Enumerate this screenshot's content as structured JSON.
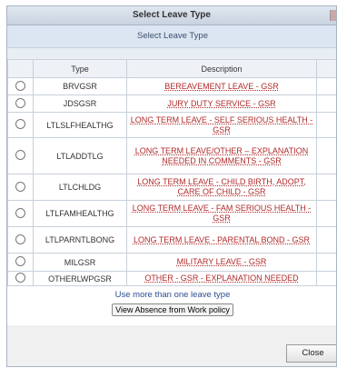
{
  "dialog": {
    "title": "Select Leave Type",
    "subtitle": "Select Leave Type",
    "table": {
      "headers": [
        "Type",
        "Description"
      ],
      "rows": [
        {
          "type": "BRVGSR",
          "description": "BEREAVEMENT LEAVE - GSR"
        },
        {
          "type": "JDSGSR",
          "description": "JURY DUTY SERVICE - GSR"
        },
        {
          "type": "LTLSLFHEALTHG",
          "description": "LONG TERM LEAVE - SELF SERIOUS HEALTH - GSR"
        },
        {
          "type": "LTLADDTLG",
          "description": "LONG TERM LEAVE/OTHER – EXPLANATION NEEDED IN COMMENTS - GSR"
        },
        {
          "type": "LTLCHLDG",
          "description": "LONG TERM LEAVE - CHILD BIRTH, ADOPT, CARE OF CHILD - GSR"
        },
        {
          "type": "LTLFAMHEALTHG",
          "description": "LONG TERM LEAVE - FAM SERIOUS HEALTH - GSR"
        },
        {
          "type": "LTLPARNTLBONG",
          "description": "LONG TERM LEAVE - PARENTAL BOND - GSR"
        },
        {
          "type": "MILGSR",
          "description": "MILITARY LEAVE - GSR"
        },
        {
          "type": "OTHERLWPGSR",
          "description": "OTHER - GSR - EXPLANATION NEEDED"
        }
      ]
    },
    "more_link": "Use more than one leave type",
    "policy_button": "View Absence from Work policy",
    "close_button": "Close"
  }
}
